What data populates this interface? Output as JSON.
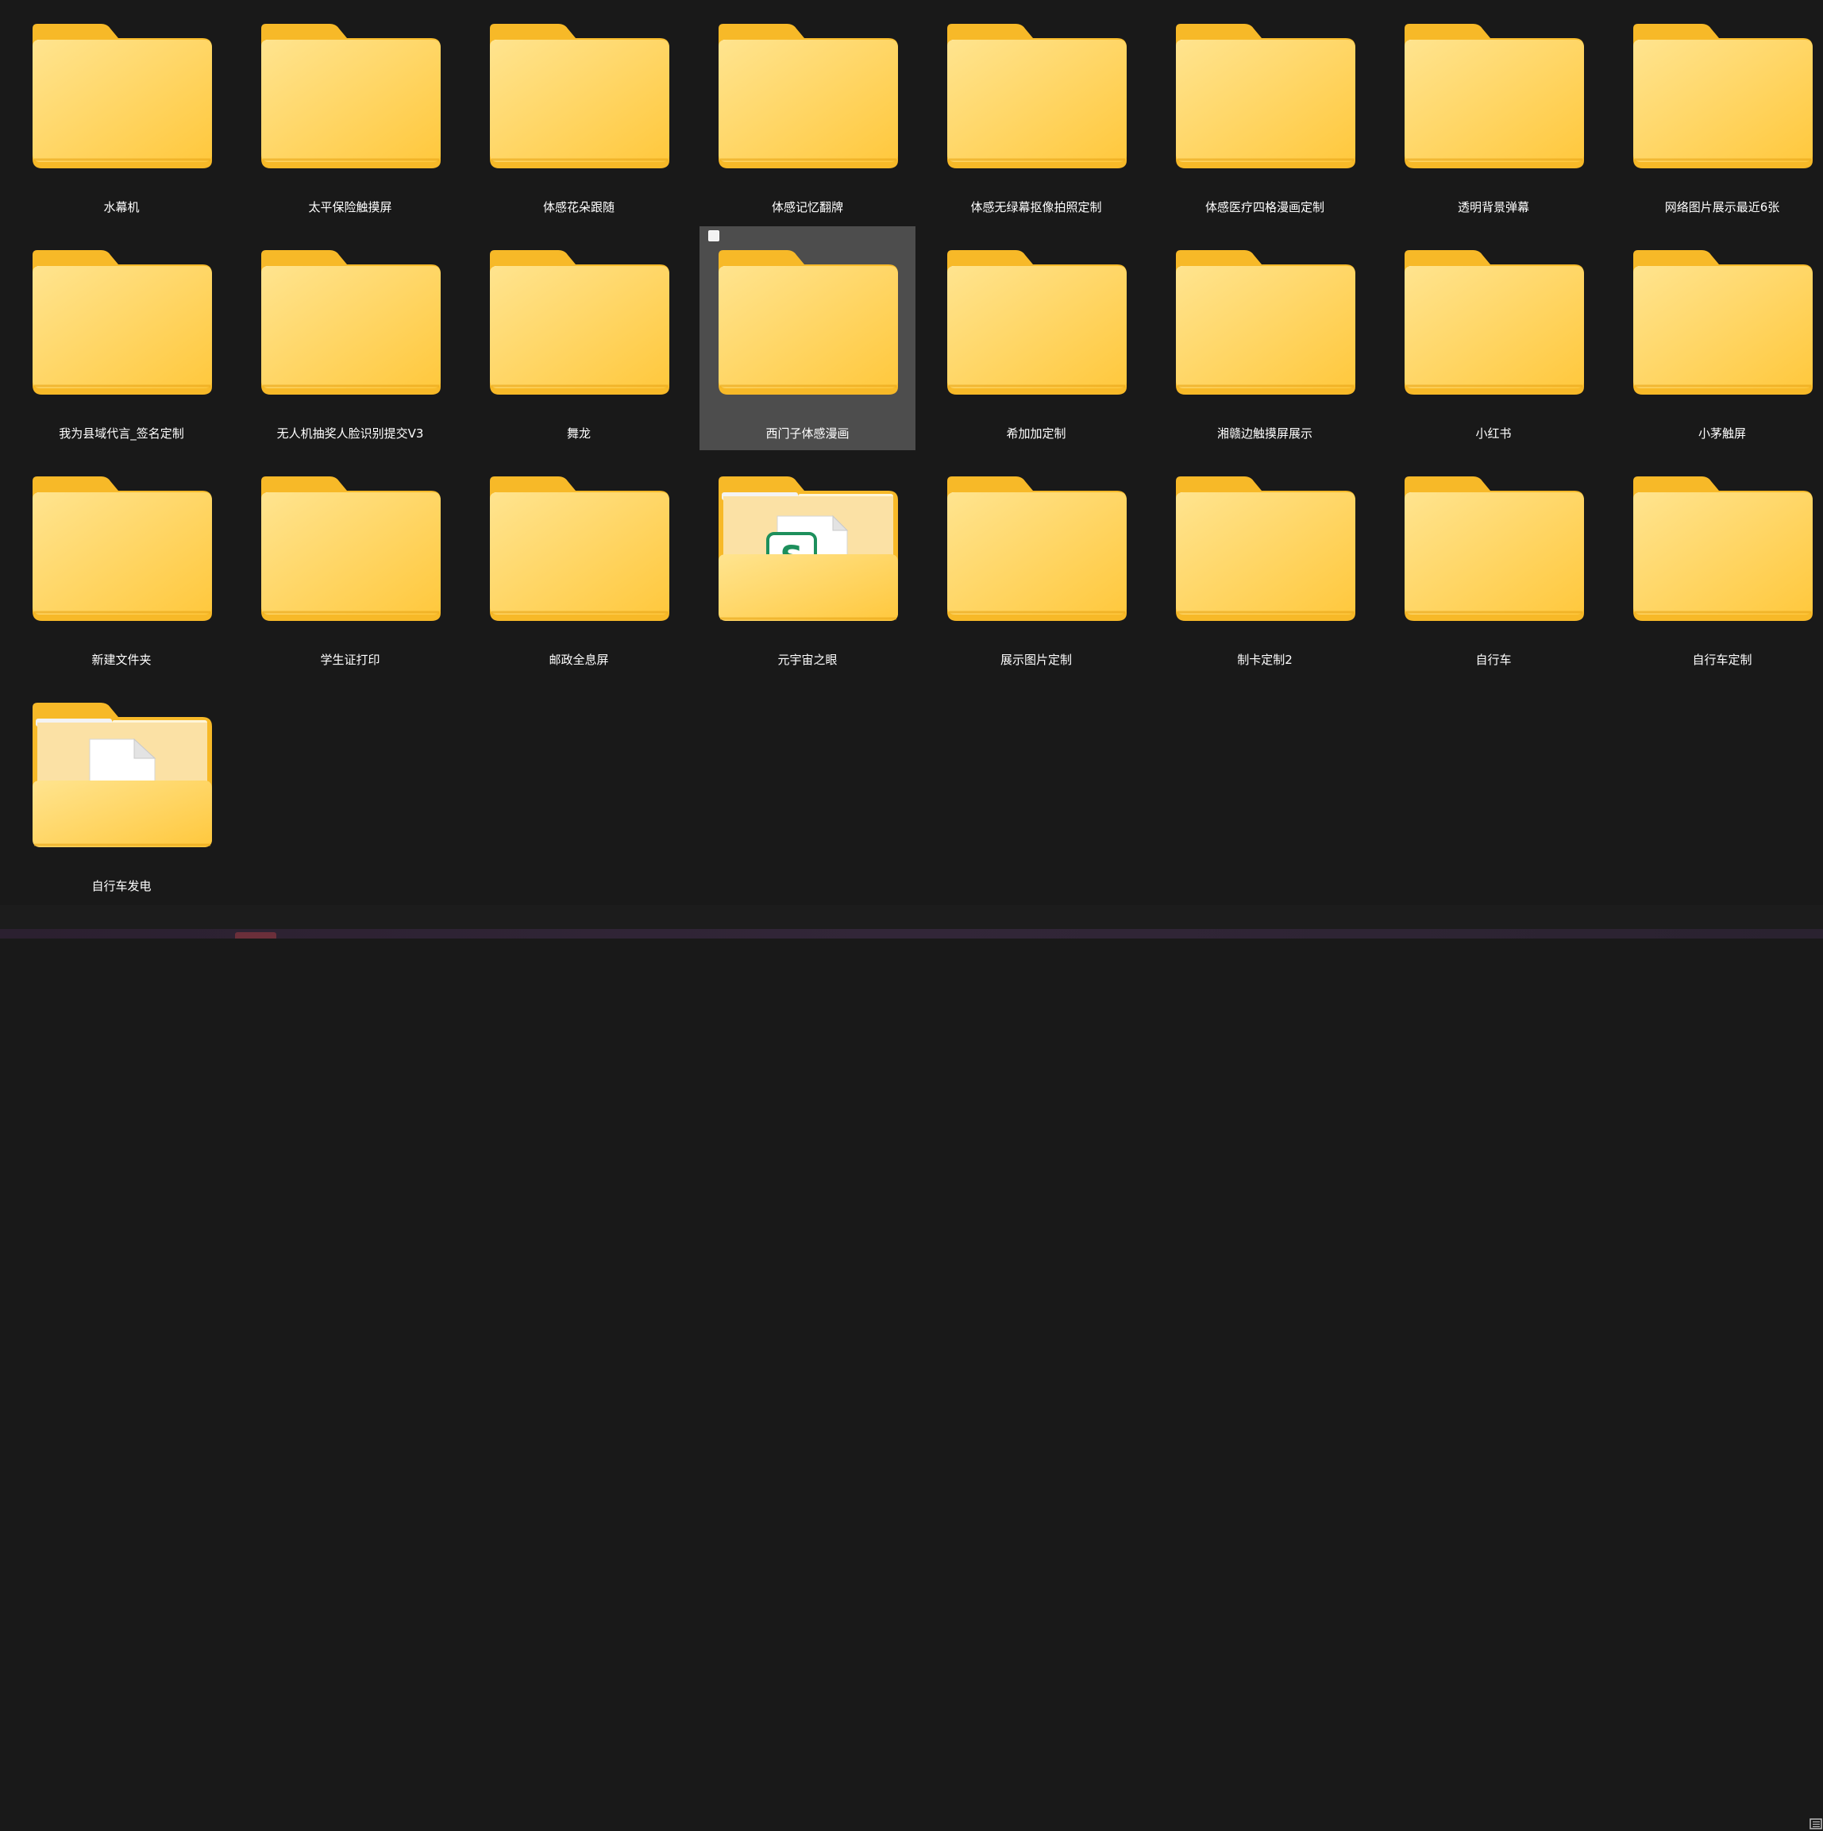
{
  "colors": {
    "background": "#191919",
    "selection": "#4d4d4d",
    "folder_back": "#f7b928",
    "folder_front_top": "#ffe48f",
    "folder_front_bottom": "#ffc83d",
    "wps_green": "#1d8f5c"
  },
  "folders": [
    {
      "label": "水幕机",
      "icon": "folder-icon"
    },
    {
      "label": "太平保险触摸屏",
      "icon": "folder-icon"
    },
    {
      "label": "体感花朵跟随",
      "icon": "folder-icon"
    },
    {
      "label": "体感记忆翻牌",
      "icon": "folder-icon"
    },
    {
      "label": "体感无绿幕抠像拍照定制",
      "icon": "folder-icon"
    },
    {
      "label": "体感医疗四格漫画定制",
      "icon": "folder-icon"
    },
    {
      "label": "透明背景弹幕",
      "icon": "folder-icon"
    },
    {
      "label": "网络图片展示最近6张",
      "icon": "folder-icon"
    },
    {
      "label": "我为县域代言_签名定制",
      "icon": "folder-icon"
    },
    {
      "label": "无人机抽奖人脸识别提交V3",
      "icon": "folder-icon"
    },
    {
      "label": "舞龙",
      "icon": "folder-icon"
    },
    {
      "label": "西门子体感漫画",
      "icon": "folder-icon",
      "selected": true
    },
    {
      "label": "希加加定制",
      "icon": "folder-icon"
    },
    {
      "label": "湘赣边触摸屏展示",
      "icon": "folder-icon"
    },
    {
      "label": "小红书",
      "icon": "folder-icon"
    },
    {
      "label": "小茅触屏",
      "icon": "folder-icon"
    },
    {
      "label": "新建文件夹",
      "icon": "folder-icon"
    },
    {
      "label": "学生证打印",
      "icon": "folder-icon"
    },
    {
      "label": "邮政全息屏",
      "icon": "folder-icon"
    },
    {
      "label": "元宇宙之眼",
      "icon": "folder-with-spreadsheet-icon"
    },
    {
      "label": "展示图片定制",
      "icon": "folder-icon"
    },
    {
      "label": "制卡定制2",
      "icon": "folder-icon"
    },
    {
      "label": "自行车",
      "icon": "folder-icon"
    },
    {
      "label": "自行车定制",
      "icon": "folder-icon"
    },
    {
      "label": "自行车发电",
      "icon": "folder-with-document-icon"
    }
  ]
}
